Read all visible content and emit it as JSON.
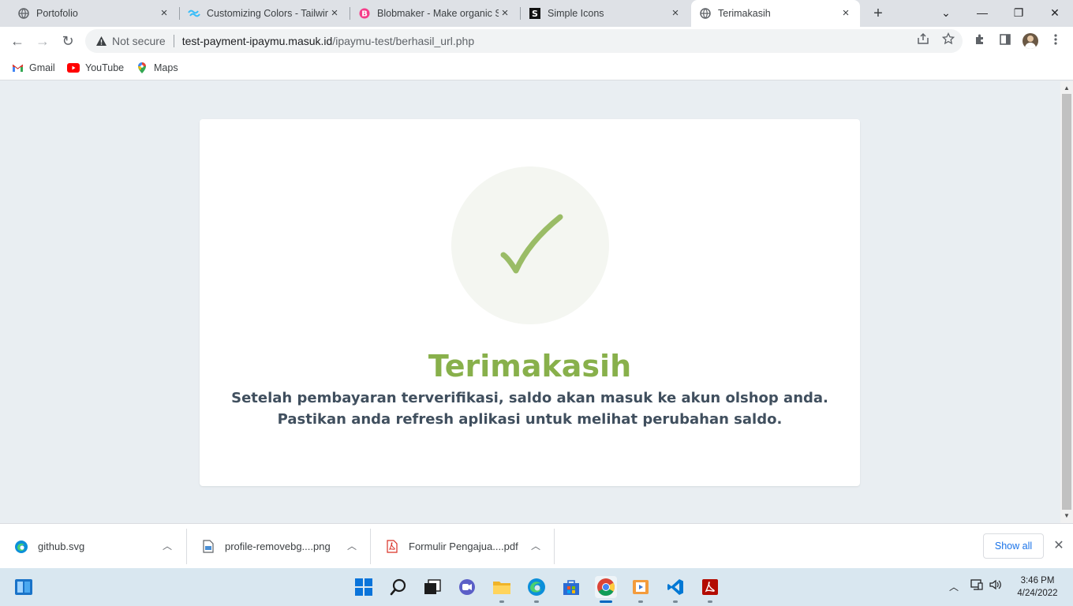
{
  "tabs": [
    {
      "title": "Portofolio",
      "icon": "globe-icon"
    },
    {
      "title": "Customizing Colors - Tailwind CSS",
      "icon": "tailwind-icon"
    },
    {
      "title": "Blobmaker - Make organic SVG shapes",
      "icon": "blobmaker-icon"
    },
    {
      "title": "Simple Icons",
      "icon": "simpleicons-icon"
    },
    {
      "title": "Terimakasih",
      "icon": "globe-icon",
      "active": true
    }
  ],
  "window_controls": {
    "minimize": "—",
    "restore": "❐",
    "close": "✕",
    "tab_search": "⌄",
    "new_tab": "+"
  },
  "toolbar": {
    "back": "←",
    "forward": "→",
    "reload": "↻",
    "security_label": "Not secure",
    "url_host": "test-payment-ipaymu.masuk.id",
    "url_path": "/ipaymu-test/berhasil_url.php"
  },
  "bookmarks": [
    {
      "label": "Gmail",
      "icon": "gmail-icon"
    },
    {
      "label": "YouTube",
      "icon": "youtube-icon"
    },
    {
      "label": "Maps",
      "icon": "maps-icon"
    }
  ],
  "page": {
    "heading": "Terimakasih",
    "line1": "Setelah pembayaran terverifikasi, saldo akan masuk ke akun olshop anda.",
    "line2": "Pastikan anda refresh aplikasi untuk melihat perubahan saldo.",
    "accent_color": "#88b04b",
    "text_color": "#404f5e"
  },
  "downloads": [
    {
      "name": "github.svg",
      "icon": "edge-file-icon"
    },
    {
      "name": "profile-removebg....png",
      "icon": "image-file-icon"
    },
    {
      "name": "Formulir Pengajua....pdf",
      "icon": "pdf-file-icon"
    }
  ],
  "shelf": {
    "show_all": "Show all"
  },
  "taskbar": {
    "time": "3:46 PM",
    "date": "4/24/2022"
  }
}
